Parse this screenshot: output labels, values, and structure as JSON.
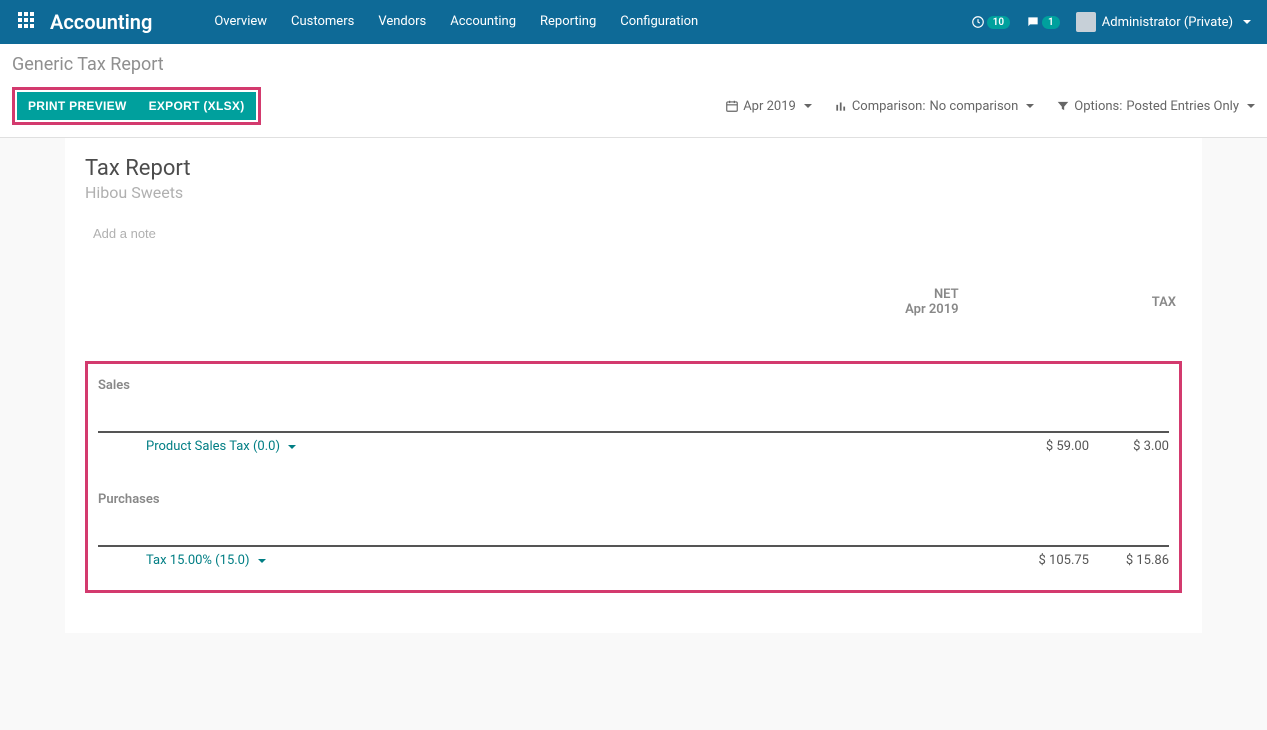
{
  "navbar": {
    "brand": "Accounting",
    "items": [
      "Overview",
      "Customers",
      "Vendors",
      "Accounting",
      "Reporting",
      "Configuration"
    ],
    "activity_count": "10",
    "message_count": "1",
    "user_label": "Administrator (Private)"
  },
  "breadcrumb": "Generic Tax Report",
  "toolbar": {
    "print_preview": "PRINT PREVIEW",
    "export_xlsx": "EXPORT (XLSX)"
  },
  "filters": {
    "period": "Apr 2019",
    "comparison_label": "Comparison:",
    "comparison_value": "No comparison",
    "options_label": "Options:",
    "options_value": "Posted Entries Only"
  },
  "report": {
    "title": "Tax Report",
    "company": "Hibou Sweets",
    "note_placeholder": "Add a note",
    "header_net": "NET",
    "header_net_sub": "Apr 2019",
    "header_tax": "TAX",
    "section_sales": "Sales",
    "section_purchases": "Purchases",
    "sales_line_label": "Product Sales Tax (0.0)",
    "sales_line_net": "$ 59.00",
    "sales_line_tax": "$ 3.00",
    "purch_line_label": "Tax 15.00% (15.0)",
    "purch_line_net": "$ 105.75",
    "purch_line_tax": "$ 15.86"
  }
}
